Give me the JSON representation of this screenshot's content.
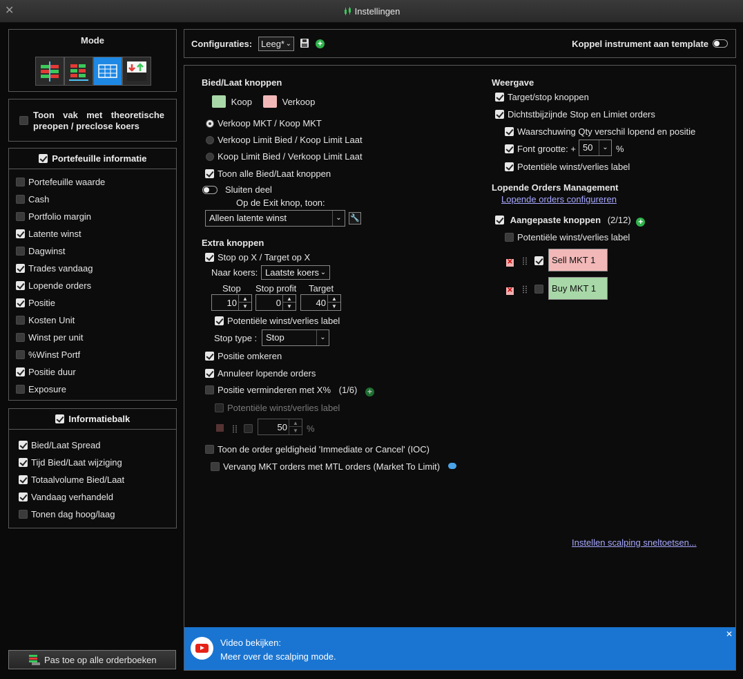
{
  "window": {
    "title": "Instellingen",
    "close_icon": "close-icon"
  },
  "mode": {
    "heading": "Mode",
    "buttons": [
      "mode-ladder-vertical",
      "mode-ladder-horizontal",
      "mode-scalping-grid",
      "mode-buy-sell-arrows"
    ],
    "active_index": 2
  },
  "theoretical": {
    "label_line1": "Toon vak met theoretische",
    "label_line2": "preopen / preclose koers",
    "checked": false
  },
  "portfolio": {
    "heading": "Portefeuille informatie",
    "heading_checked": true,
    "items": [
      {
        "label": "Portefeuille waarde",
        "checked": false
      },
      {
        "label": "Cash",
        "checked": false
      },
      {
        "label": "Portfolio margin",
        "checked": false
      },
      {
        "label": "Latente winst",
        "checked": true
      },
      {
        "label": "Dagwinst",
        "checked": false
      },
      {
        "label": "Trades vandaag",
        "checked": true
      },
      {
        "label": "Lopende orders",
        "checked": true
      },
      {
        "label": "Positie",
        "checked": true
      },
      {
        "label": "Kosten Unit",
        "checked": false
      },
      {
        "label": "Winst per unit",
        "checked": false
      },
      {
        "label": "%Winst Portf",
        "checked": false
      },
      {
        "label": "Positie duur",
        "checked": true
      },
      {
        "label": "Exposure",
        "checked": false
      }
    ]
  },
  "infobar": {
    "heading": "Informatiebalk",
    "heading_checked": true,
    "items": [
      {
        "label": "Bied/Laat Spread",
        "checked": true
      },
      {
        "label": "Tijd Bied/Laat wijziging",
        "checked": true
      },
      {
        "label": "Totaalvolume Bied/Laat",
        "checked": true
      },
      {
        "label": "Vandaag verhandeld",
        "checked": true
      },
      {
        "label": "Tonen dag hoog/laag",
        "checked": false
      }
    ]
  },
  "apply_button": "Pas toe op alle orderboeken",
  "config": {
    "label": "Configuraties:",
    "value": "Leeg*",
    "template_label": "Koppel instrument aan template"
  },
  "bid_ask": {
    "heading": "Bied/Laat knoppen",
    "buy_label": "Koop",
    "sell_label": "Verkoop",
    "buy_color": "#a8d8a8",
    "sell_color": "#f2b8b8",
    "radios": [
      "Verkoop MKT / Koop MKT",
      "Verkoop Limit Bied / Koop Limit Laat",
      "Koop Limit Bied / Verkoop Limit Laat"
    ],
    "radio_selected": 0,
    "show_all": "Toon alle Bied/Laat knoppen",
    "close_part": "Sluiten deel",
    "exit_label": "Op de Exit knop, toon:",
    "exit_value": "Alleen latente winst"
  },
  "extra": {
    "heading": "Extra knoppen",
    "stop_target": "Stop op X / Target op X",
    "naar_koers": "Naar koers:",
    "naar_value": "Laatste koers",
    "col_stop": "Stop",
    "col_stop_profit": "Stop profit",
    "col_target": "Target",
    "stop_val": "10",
    "stop_profit_val": "0",
    "target_val": "40",
    "pot_label": "Potentiële winst/verlies label",
    "stop_type_label": "Stop type :",
    "stop_type_value": "Stop",
    "reverse": "Positie omkeren",
    "cancel_orders": "Annuleer lopende orders",
    "reduce": "Positie verminderen met X%",
    "reduce_count": "(1/6)",
    "reduce_pot": "Potentiële winst/verlies label",
    "reduce_val": "50",
    "reduce_pct": "%",
    "ioc": "Toon de order geldigheid 'Immediate or Cancel' (IOC)",
    "mtl": "Vervang MKT orders met MTL orders (Market To Limit)"
  },
  "display": {
    "heading": "Weergave",
    "items": [
      {
        "label": "Target/stop knoppen",
        "checked": true
      },
      {
        "label": "Dichtstbijzijnde Stop en Limiet orders",
        "checked": true
      }
    ],
    "sub_items": [
      "Waarschuwing Qty verschil lopend en positie",
      "Font grootte: +",
      "Potentiële winst/verlies label"
    ],
    "font_value": "50",
    "font_pct": "%"
  },
  "orders_mgmt": {
    "heading": "Lopende Orders Management",
    "configure_link": "Lopende orders configureren",
    "custom_label": "Aangepaste knoppen",
    "custom_count": "(2/12)",
    "pot_label": "Potentiële winst/verlies label",
    "buttons": [
      {
        "label": "Sell MKT 1",
        "color": "#f2b8b8",
        "checked": true
      },
      {
        "label": "Buy MKT 1",
        "color": "#a8d8a8",
        "checked": false
      }
    ]
  },
  "scalping_link": "Instellen scalping sneltoetsen...",
  "video": {
    "line1": "Video bekijken:",
    "line2": "Meer over de scalping mode.",
    "bg": "#1a75d2"
  }
}
